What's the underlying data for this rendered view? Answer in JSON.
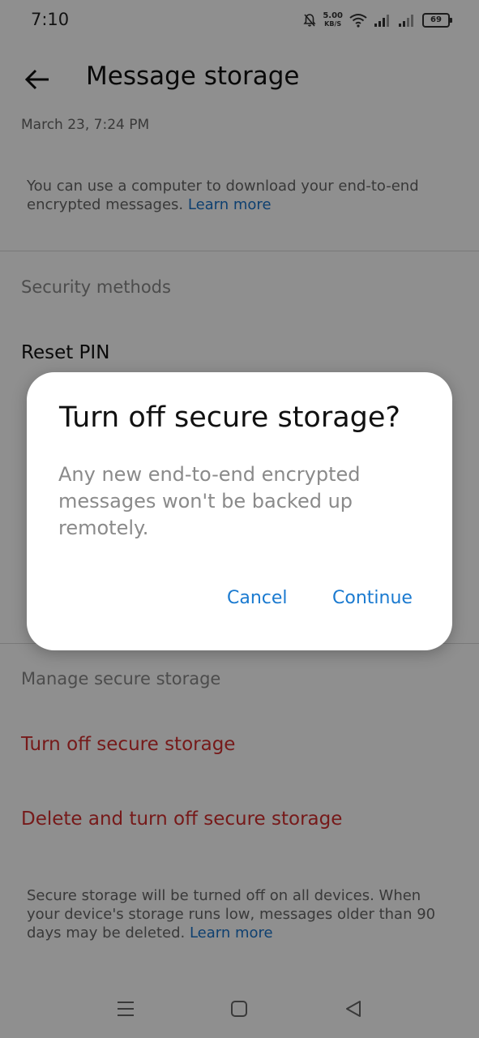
{
  "status_bar": {
    "time": "7:10",
    "net_speed_value": "5.00",
    "net_speed_unit": "KB/S",
    "battery": "69",
    "icons": [
      "mute-bell-icon",
      "wifi-icon",
      "signal-icon",
      "signal-icon",
      "battery-icon"
    ]
  },
  "header": {
    "title": "Message storage",
    "back_icon": "arrow-left-icon"
  },
  "subtitle": "March 23, 7:24 PM",
  "info": {
    "text": "You can use a computer to download your end-to-end encrypted messages. ",
    "link": "Learn more"
  },
  "security": {
    "section_label": "Security methods",
    "items": [
      "Reset PIN"
    ]
  },
  "manage": {
    "section_label": "Manage secure storage",
    "turn_off": "Turn off secure storage",
    "delete_turn_off": "Delete and turn off secure storage"
  },
  "footer": {
    "text": "Secure storage will be turned off on all devices. When your device's storage runs low, messages older than 90 days may be deleted. ",
    "link": "Learn more"
  },
  "dialog": {
    "title": "Turn off secure storage?",
    "message": "Any new end-to-end encrypted messages won't be backed up remotely.",
    "cancel": "Cancel",
    "continue": "Continue"
  },
  "nav_bar": {
    "icons": [
      "menu-icon",
      "home-square-icon",
      "back-triangle-icon"
    ]
  },
  "colors": {
    "accent": "#1a7ad0",
    "link": "#1a73c8",
    "danger": "#d32f2f",
    "scrim": "rgba(0,0,0,0.44)"
  }
}
